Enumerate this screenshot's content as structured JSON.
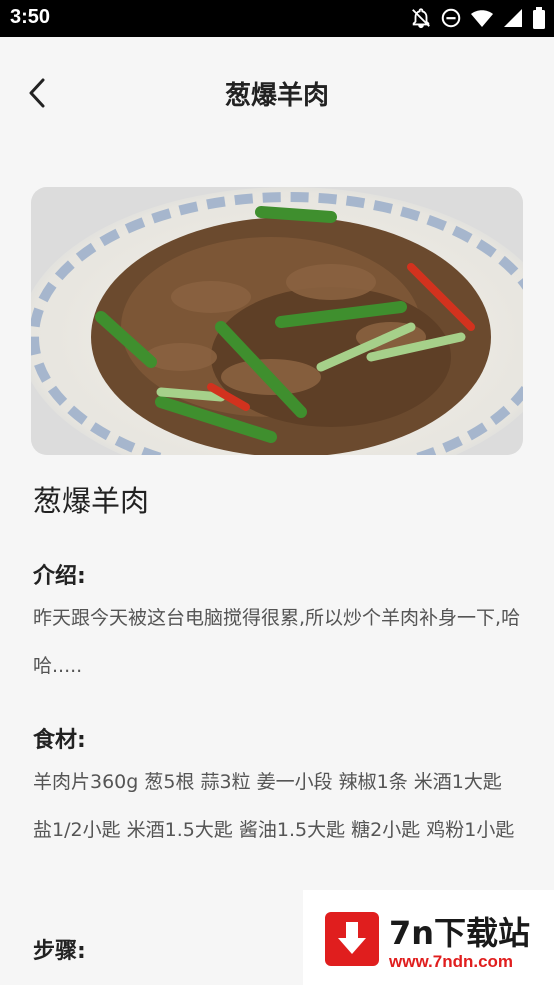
{
  "status_bar": {
    "time": "3:50",
    "icons": [
      "notifications-off-icon",
      "do-not-disturb-icon",
      "wifi-icon",
      "signal-icon",
      "battery-icon"
    ]
  },
  "header": {
    "title": "葱爆羊肉",
    "back_icon": "chevron-left-icon"
  },
  "recipe": {
    "name": "葱爆羊肉",
    "intro_heading": "介绍:",
    "intro_text": "昨天跟今天被这台电脑搅得很累,所以炒个羊肉补身一下,哈哈.....",
    "ingredients_heading": "食材:",
    "ingredients_text": "羊肉片360g 葱5根 蒜3粒 姜一小段 辣椒1条 米酒1大匙 盐1/2小匙 米酒1.5大匙 酱油1.5大匙 糖2小匙 鸡粉1小匙",
    "steps_heading": "步骤:"
  },
  "watermark": {
    "brand": "7n下载站",
    "url": "www.7ndn.com"
  },
  "colors": {
    "status_bar": "#000000",
    "background": "#f6f6f6",
    "text": "#222222",
    "body_text": "#555555",
    "watermark_red": "#e01e1e"
  }
}
